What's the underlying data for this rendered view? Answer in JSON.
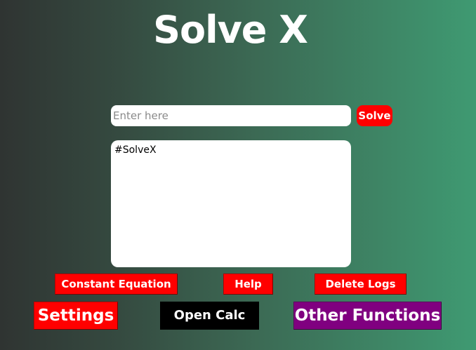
{
  "app": {
    "title": "Solve X"
  },
  "equation_input": {
    "value": "",
    "placeholder": "Enter here"
  },
  "solve_button": {
    "label": "Solve"
  },
  "log": {
    "text": "#SolveX"
  },
  "toolbar": {
    "constant_equation_label": "Constant Equation",
    "help_label": "Help",
    "delete_logs_label": "Delete Logs"
  },
  "footer": {
    "settings_label": "Settings",
    "open_calc_label": "Open Calc",
    "other_functions_label": "Other Functions"
  },
  "colors": {
    "gradient_start": "#2f3432",
    "gradient_end": "#3f9a72",
    "primary_button": "#ff0000",
    "calc_button": "#000000",
    "other_functions_button": "#800080",
    "title_text": "#ffffff"
  }
}
